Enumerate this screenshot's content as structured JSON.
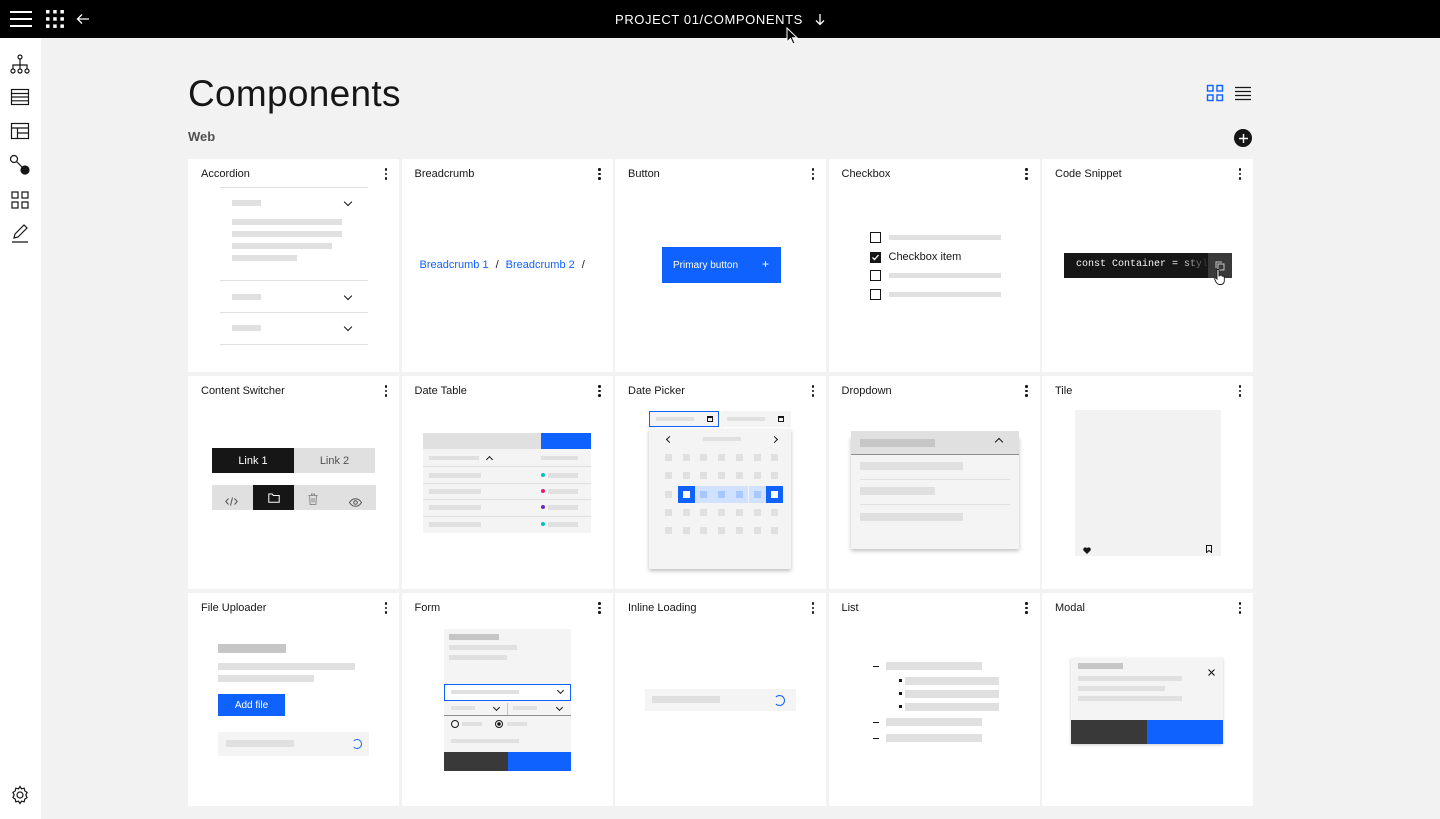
{
  "header": {
    "title": "PROJECT 01/COMPONENTS",
    "icons": [
      "menu-icon",
      "app-switcher-icon",
      "arrow-left-icon",
      "arrow-down-icon"
    ]
  },
  "rail": {
    "icons": [
      "hierarchy-icon",
      "table-icon",
      "layout-icon",
      "connect-icon",
      "grid-icon",
      "edit-icon",
      "settings-icon"
    ]
  },
  "page": {
    "title": "Components",
    "section": "Web",
    "view_icons": [
      "grid-view-icon",
      "list-view-icon"
    ],
    "add_icon": "add-icon"
  },
  "cards": [
    {
      "title": "Accordion"
    },
    {
      "title": "Breadcrumb"
    },
    {
      "title": "Button"
    },
    {
      "title": "Checkbox"
    },
    {
      "title": "Code Snippet"
    },
    {
      "title": "Content Switcher"
    },
    {
      "title": "Date Table"
    },
    {
      "title": "Date Picker"
    },
    {
      "title": "Dropdown"
    },
    {
      "title": "Tile"
    },
    {
      "title": "File Uploader"
    },
    {
      "title": "Form"
    },
    {
      "title": "Inline Loading"
    },
    {
      "title": "List"
    },
    {
      "title": "Modal"
    }
  ],
  "previews": {
    "breadcrumb": {
      "item1": "Breadcrumb 1",
      "item2": "Breadcrumb 2",
      "sep": "/"
    },
    "button": {
      "label": "Primary button",
      "icon": "+"
    },
    "checkbox": {
      "label": "Checkbox item"
    },
    "code_snippet": {
      "code": "const Container = style"
    },
    "content_switcher": {
      "link1": "Link 1",
      "link2": "Link 2"
    },
    "file_uploader": {
      "button": "Add file"
    }
  },
  "colors": {
    "accent": "#0f62fe",
    "topbar": "#000000",
    "background": "#f2f2f2"
  }
}
